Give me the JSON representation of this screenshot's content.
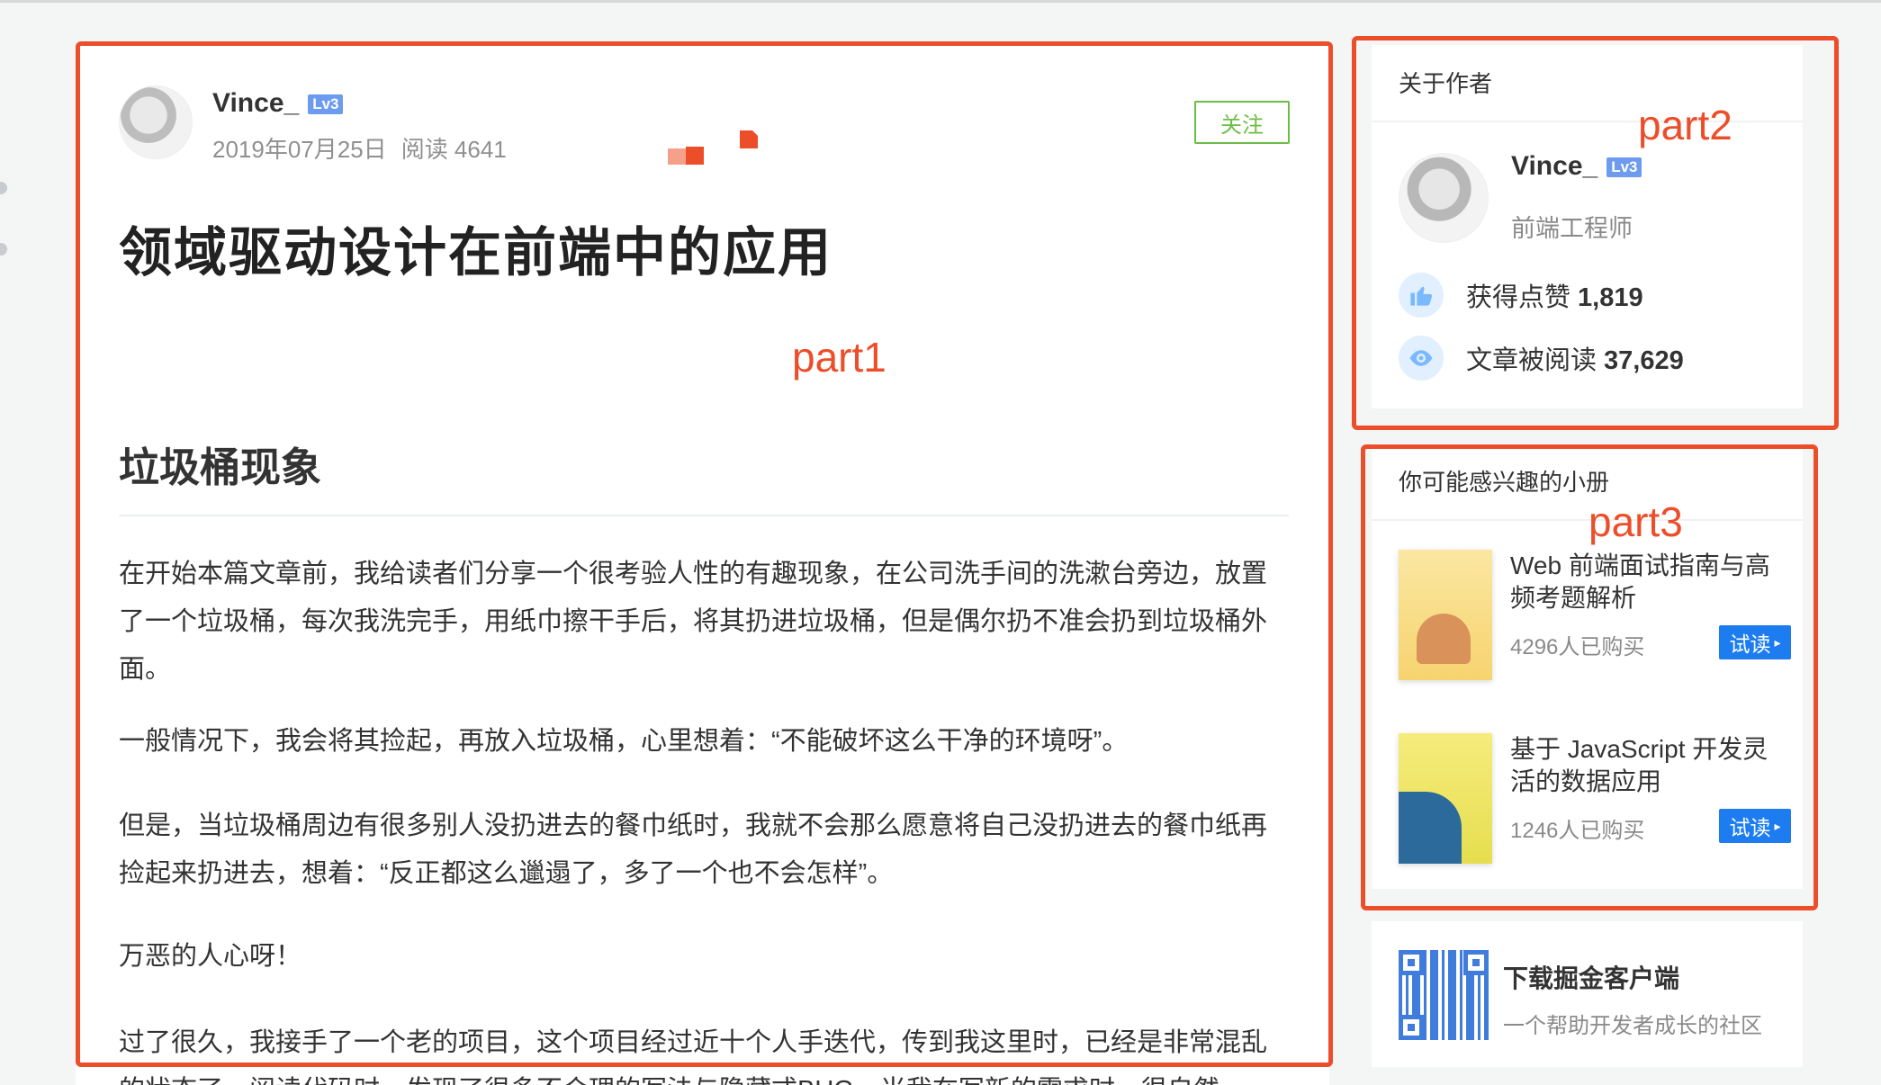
{
  "article": {
    "author_name": "Vince_",
    "level_badge": "Lv3",
    "date": "2019年07月25日",
    "reads": "阅读 4641",
    "follow_label": "关注",
    "title": "领域驱动设计在前端中的应用",
    "section_heading": "垃圾桶现象",
    "paragraphs": [
      "在开始本篇文章前，我给读者们分享一个很考验人性的有趣现象，在公司洗手间的洗漱台旁边，放置了一个垃圾桶，每次我洗完手，用纸巾擦干手后，将其扔进垃圾桶，但是偶尔扔不准会扔到垃圾桶外面。",
      "一般情况下，我会将其捡起，再放入垃圾桶，心里想着：“不能破坏这么干净的环境呀”。",
      "但是，当垃圾桶周边有很多别人没扔进去的餐巾纸时，我就不会那么愿意将自己没扔进去的餐巾纸再捡起来扔进去，想着：“反正都这么邋遢了，多了一个也不会怎样”。",
      "万恶的人心呀！",
      "过了很久，我接手了一个老的项目，这个项目经过近十个人手迭代，传到我这里时，已经是非常混乱的状态了，阅读代码时，发现了很多不合理的写法与隐藏式BUG，当我在写新的需求时，很自然"
    ]
  },
  "annotations": {
    "part1": "part1",
    "part2": "part2",
    "part3": "part3"
  },
  "about_author": {
    "heading": "关于作者",
    "name": "Vince_",
    "level_badge": "Lv3",
    "job": "前端工程师",
    "likes_label": "获得点赞",
    "likes_value": "1,819",
    "reads_label": "文章被阅读",
    "reads_value": "37,629",
    "icons": [
      "thumbs-up-icon",
      "eye-icon"
    ]
  },
  "booklets": {
    "heading": "你可能感兴趣的小册",
    "items": [
      {
        "title": "Web 前端面试指南与高频考题解析",
        "sold": "4296人已购买",
        "try_label": "试读"
      },
      {
        "title": "基于 JavaScript 开发灵活的数据应用",
        "sold": "1246人已购买",
        "try_label": "试读"
      }
    ]
  },
  "download": {
    "title": "下载掘金客户端",
    "subtitle": "一个帮助开发者成长的社区"
  },
  "colors": {
    "annotation": "#ed4e2a",
    "follow_green": "#6cbd45",
    "try_blue": "#1d7df0",
    "badge_blue": "#6c9bf0"
  }
}
